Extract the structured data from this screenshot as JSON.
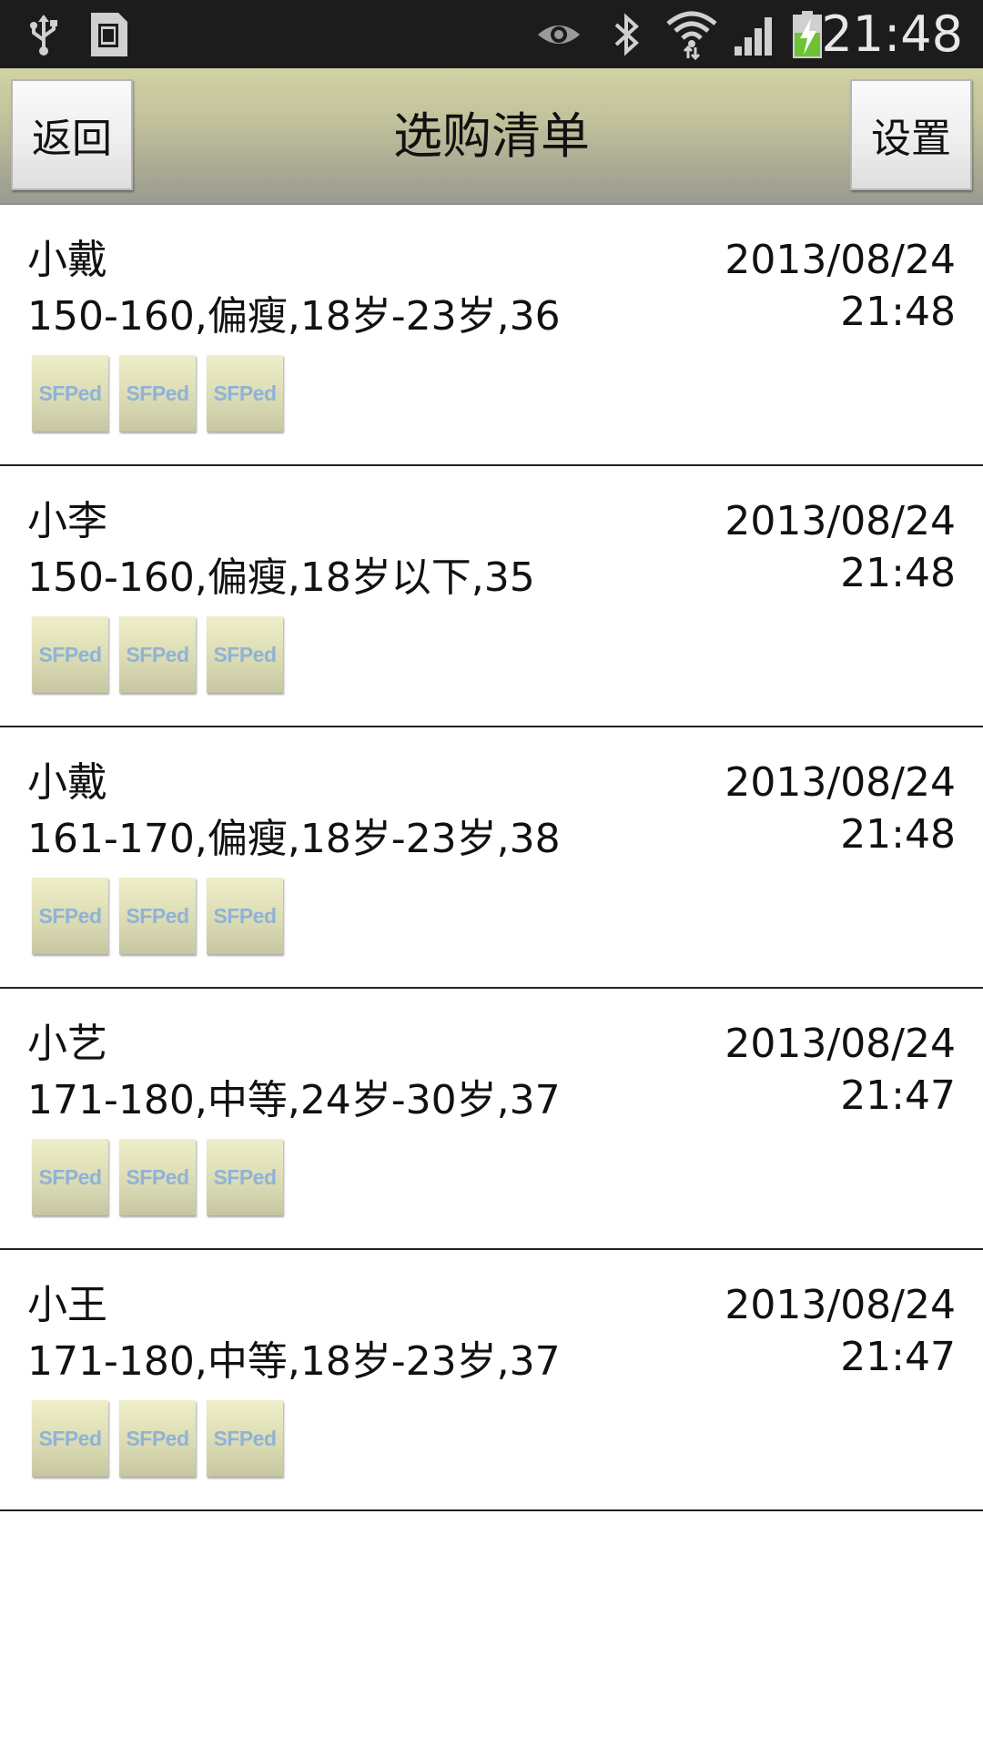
{
  "status_bar": {
    "time": "21:48",
    "icons": [
      "usb-icon",
      "sd-card-icon",
      "eye-icon",
      "bluetooth-icon",
      "wifi-icon",
      "signal-icon",
      "battery-charging-icon"
    ],
    "battery_color": "#6fc235"
  },
  "header": {
    "back_label": "返回",
    "title": "选购清单",
    "settings_label": "设置"
  },
  "list": {
    "thumb_label": "SFPed",
    "items": [
      {
        "name": "小戴",
        "detail": "150-160,偏瘦,18岁-23岁,36",
        "date": "2013/08/24",
        "time": "21:48"
      },
      {
        "name": "小李",
        "detail": "150-160,偏瘦,18岁以下,35",
        "date": "2013/08/24",
        "time": "21:48"
      },
      {
        "name": "小戴",
        "detail": "161-170,偏瘦,18岁-23岁,38",
        "date": "2013/08/24",
        "time": "21:48"
      },
      {
        "name": "小艺",
        "detail": "171-180,中等,24岁-30岁,37",
        "date": "2013/08/24",
        "time": "21:47"
      },
      {
        "name": "小王",
        "detail": "171-180,中等,18岁-23岁,37",
        "date": "2013/08/24",
        "time": "21:47"
      }
    ]
  }
}
